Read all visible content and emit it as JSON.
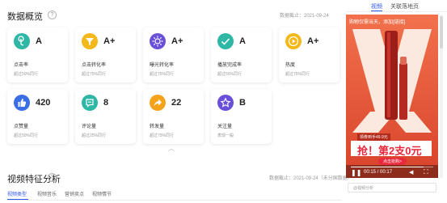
{
  "overview": {
    "title": "数据概览",
    "help_glyph": "?",
    "date": "数据截止：2021-09-24"
  },
  "metrics": [
    {
      "grade": "A",
      "label": "点击率",
      "sub": "超过50%同行",
      "color": "#2fb7a6",
      "icon": "tap-icon"
    },
    {
      "grade": "A+",
      "label": "点击转化率",
      "sub": "超过75%同行",
      "color": "#f5b81b",
      "icon": "funnel-icon"
    },
    {
      "grade": "A+",
      "label": "曝光转化率",
      "sub": "超过75%同行",
      "color": "#6a4fd8",
      "icon": "sun-icon"
    },
    {
      "grade": "A",
      "label": "播放完成率",
      "sub": "超过50%同行",
      "color": "#2fb7a6",
      "icon": "check-icon"
    },
    {
      "grade": "A+",
      "label": "热度",
      "sub": "超过75%同行",
      "color": "#f5b81b",
      "icon": "play-icon"
    },
    {
      "grade": "420",
      "label": "点赞量",
      "sub": "超过50%同行",
      "color": "#3b6fe6",
      "icon": "thumbs-up-icon"
    },
    {
      "grade": "8",
      "label": "评论量",
      "sub": "超过25%同行",
      "color": "#2fb7a6",
      "icon": "comment-icon"
    },
    {
      "grade": "22",
      "label": "转发量",
      "sub": "超过75%同行",
      "color": "#f5a31b",
      "icon": "share-icon"
    },
    {
      "grade": "B",
      "label": "关注量",
      "sub": "表现一般",
      "color": "#6a4fd8",
      "icon": "star-icon"
    }
  ],
  "collapse_glyph": "︿",
  "features": {
    "title": "视频特征分析",
    "help_glyph": "?",
    "date": "数据截止：2021-09-24（未分国数据）",
    "tabs": [
      "视频类型",
      "视频音乐",
      "营销卖点",
      "视频情节"
    ]
  },
  "right_panel": {
    "tab_video": "视频",
    "tab_related": "关联落地页",
    "video": {
      "caption": "购物仅需当天，添加[链接]",
      "price_tag": "领券到手49.9元",
      "promo": "抢！第2支0元",
      "button": "点击抢购>",
      "time": "00:15 / 00:17",
      "progress": 0.88,
      "play_glyph": "❚❚",
      "volume_glyph": "◀",
      "fullscreen_glyph": "⛶"
    },
    "select_placeholder": "@视频分析"
  }
}
